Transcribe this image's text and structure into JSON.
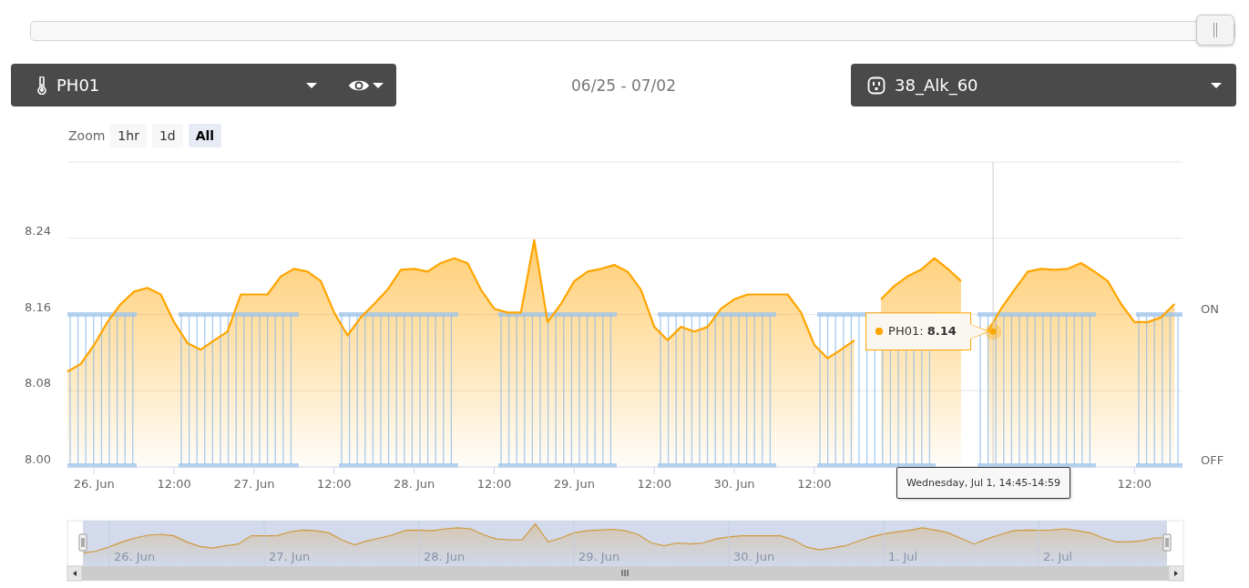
{
  "range_slider": {
    "level": 1
  },
  "date_range": "06/25 - 07/02",
  "outlet_select": {
    "value": "38_Alk_60"
  },
  "zoom": {
    "label": "Zoom",
    "buttons": [
      {
        "label": "1hr",
        "selected": false
      },
      {
        "label": "1d",
        "selected": false
      },
      {
        "label": "All",
        "selected": true
      }
    ]
  },
  "chart": {
    "chart_data": {
      "type": "area",
      "categories": [
        null,
        null,
        "26. Jun",
        null,
        null,
        null,
        null,
        null,
        "12:00",
        null,
        null,
        null,
        null,
        null,
        "27. Jun",
        null,
        null,
        null,
        null,
        null,
        "12:00",
        null,
        null,
        null,
        null,
        null,
        "28. Jun",
        null,
        null,
        null,
        null,
        null,
        "12:00",
        null,
        null,
        null,
        null,
        null,
        "29. Jun",
        null,
        null,
        null,
        null,
        null,
        "12:00",
        null,
        null,
        null,
        null,
        null,
        "30. Jun",
        null,
        null,
        null,
        null,
        null,
        "12:00",
        null,
        null,
        null,
        null,
        null,
        null,
        null,
        null,
        null,
        null,
        null,
        null,
        null,
        null,
        null,
        null,
        null,
        null,
        null,
        null,
        null,
        null,
        null,
        "12:00",
        null,
        null,
        null
      ],
      "series": [
        {
          "name": "PH01",
          "color": "#ffa500",
          "values": [
            8.1,
            8.108,
            8.128,
            8.152,
            8.171,
            8.184,
            8.188,
            8.181,
            8.152,
            8.13,
            8.123,
            8.133,
            8.142,
            8.181,
            8.181,
            8.181,
            8.2,
            8.208,
            8.205,
            8.195,
            8.162,
            8.138,
            8.157,
            8.171,
            8.186,
            8.207,
            8.208,
            8.205,
            8.214,
            8.219,
            8.214,
            8.186,
            8.166,
            8.162,
            8.162,
            8.238,
            8.152,
            8.171,
            8.195,
            8.205,
            8.208,
            8.212,
            8.205,
            8.186,
            8.147,
            8.133,
            8.147,
            8.142,
            8.147,
            8.166,
            8.176,
            8.181,
            8.181,
            8.181,
            8.181,
            8.162,
            8.128,
            8.114,
            8.123,
            8.133,
            null,
            8.176,
            8.19,
            8.2,
            8.207,
            8.219,
            8.208,
            8.195,
            null,
            8.142,
            8.166,
            8.186,
            8.205,
            8.208,
            8.207,
            8.208,
            8.214,
            8.205,
            8.195,
            8.171,
            8.152,
            8.152,
            8.157,
            8.171
          ]
        }
      ],
      "ylim": [
        8.0,
        8.32
      ],
      "yticks": [
        {
          "value": 8.0,
          "label": "8.00"
        },
        {
          "value": 8.08,
          "label": "8.08"
        },
        {
          "value": 8.16,
          "label": "8.16"
        },
        {
          "value": 8.24,
          "label": "8.24"
        }
      ],
      "grid": true,
      "annotations": [
        "PH01: **8.14**"
      ]
    },
    "time_tooltip": "Wednesday, Jul 1, 14:45-14:59",
    "right_axis_labels": [
      "ON",
      "OFF"
    ]
  },
  "navigator": {
    "labels": [
      "26. Jun",
      "27. Jun",
      "28. Jun",
      "29. Jun",
      "30. Jun",
      "1. Jul",
      "2. Jul"
    ]
  }
}
